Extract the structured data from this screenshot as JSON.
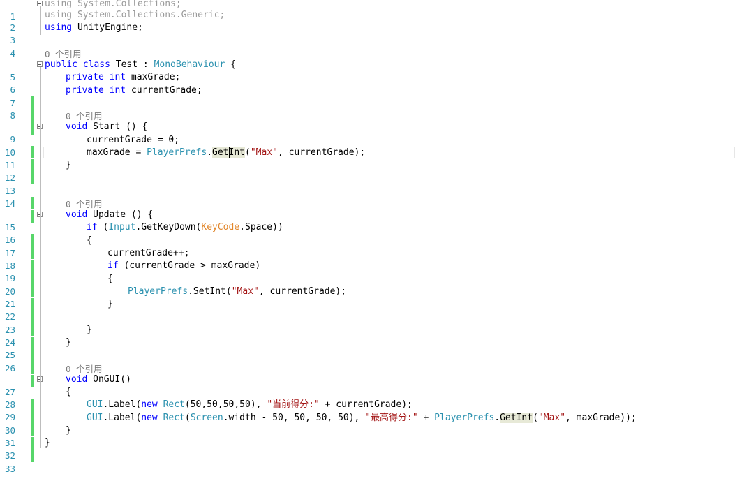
{
  "editor": {
    "line_numbers": [
      "1",
      "2",
      "3",
      "4",
      "5",
      "6",
      "7",
      "8",
      "9",
      "10",
      "11",
      "12",
      "13",
      "14",
      "15",
      "16",
      "17",
      "18",
      "19",
      "20",
      "21",
      "22",
      "23",
      "24",
      "25",
      "26",
      "27",
      "28",
      "29",
      "30",
      "31",
      "32",
      "33"
    ],
    "ref_lens": "0 个引用",
    "code": {
      "l1_using": "using",
      "l1_ns": " System.Collections;",
      "l2_using": "using",
      "l2_ns": " System.Collections.Generic;",
      "l3_using": "using",
      "l3_ns": " UnityEngine;",
      "l5_public": "public",
      "l5_class": "class",
      "l5_name": " Test : ",
      "l5_base": "MonoBehaviour",
      "l5_brace": " {",
      "l6_private": "private",
      "l6_int": "int",
      "l6_rest": " maxGrade;",
      "l7_private": "private",
      "l7_int": "int",
      "l7_rest": " currentGrade;",
      "l9_void": "void",
      "l9_rest": " Start () {",
      "l10_text": "currentGrade = 0;",
      "l11_a": "maxGrade = ",
      "l11_pp": "PlayerPrefs",
      "l11_dot": ".",
      "l11_get": "Get",
      "l11_int": "Int",
      "l11_paren": "(",
      "l11_str": "\"Max\"",
      "l11_rest": ", currentGrade);",
      "l12_text": "}",
      "l15_void": "void",
      "l15_rest": " Update () {",
      "l16_if": "if",
      "l16_a": " (",
      "l16_input": "Input",
      "l16_b": ".GetKeyDown(",
      "l16_kc": "KeyCode",
      "l16_c": ".Space))",
      "l17_text": "{",
      "l18_text": "currentGrade++;",
      "l19_if": "if",
      "l19_rest": " (currentGrade > maxGrade)",
      "l20_text": "{",
      "l21_pp": "PlayerPrefs",
      "l21_a": ".SetInt(",
      "l21_str": "\"Max\"",
      "l21_rest": ", currentGrade);",
      "l22_text": "}",
      "l24_text": "}",
      "l25_text": "}",
      "l27_void": "void",
      "l27_rest": " OnGUI()",
      "l28_text": "{",
      "l29_gui": "GUI",
      "l29_a": ".Label(",
      "l29_new": "new",
      "l29_sp": " ",
      "l29_rect": "Rect",
      "l29_b": "(50,50,50,50), ",
      "l29_str": "\"当前得分:\"",
      "l29_rest": " + currentGrade);",
      "l30_gui": "GUI",
      "l30_a": ".Label(",
      "l30_new": "new",
      "l30_sp": " ",
      "l30_rect": "Rect",
      "l30_b": "(",
      "l30_screen": "Screen",
      "l30_c": ".width - 50, 50, 50, 50), ",
      "l30_str": "\"最高得分:\"",
      "l30_d": " + ",
      "l30_pp": "PlayerPrefs",
      "l30_e": ".",
      "l30_getint": "GetInt",
      "l30_f": "(",
      "l30_str2": "\"Max\"",
      "l30_rest": ", maxGrade));",
      "l31_text": "}",
      "l32_text": "}"
    }
  }
}
